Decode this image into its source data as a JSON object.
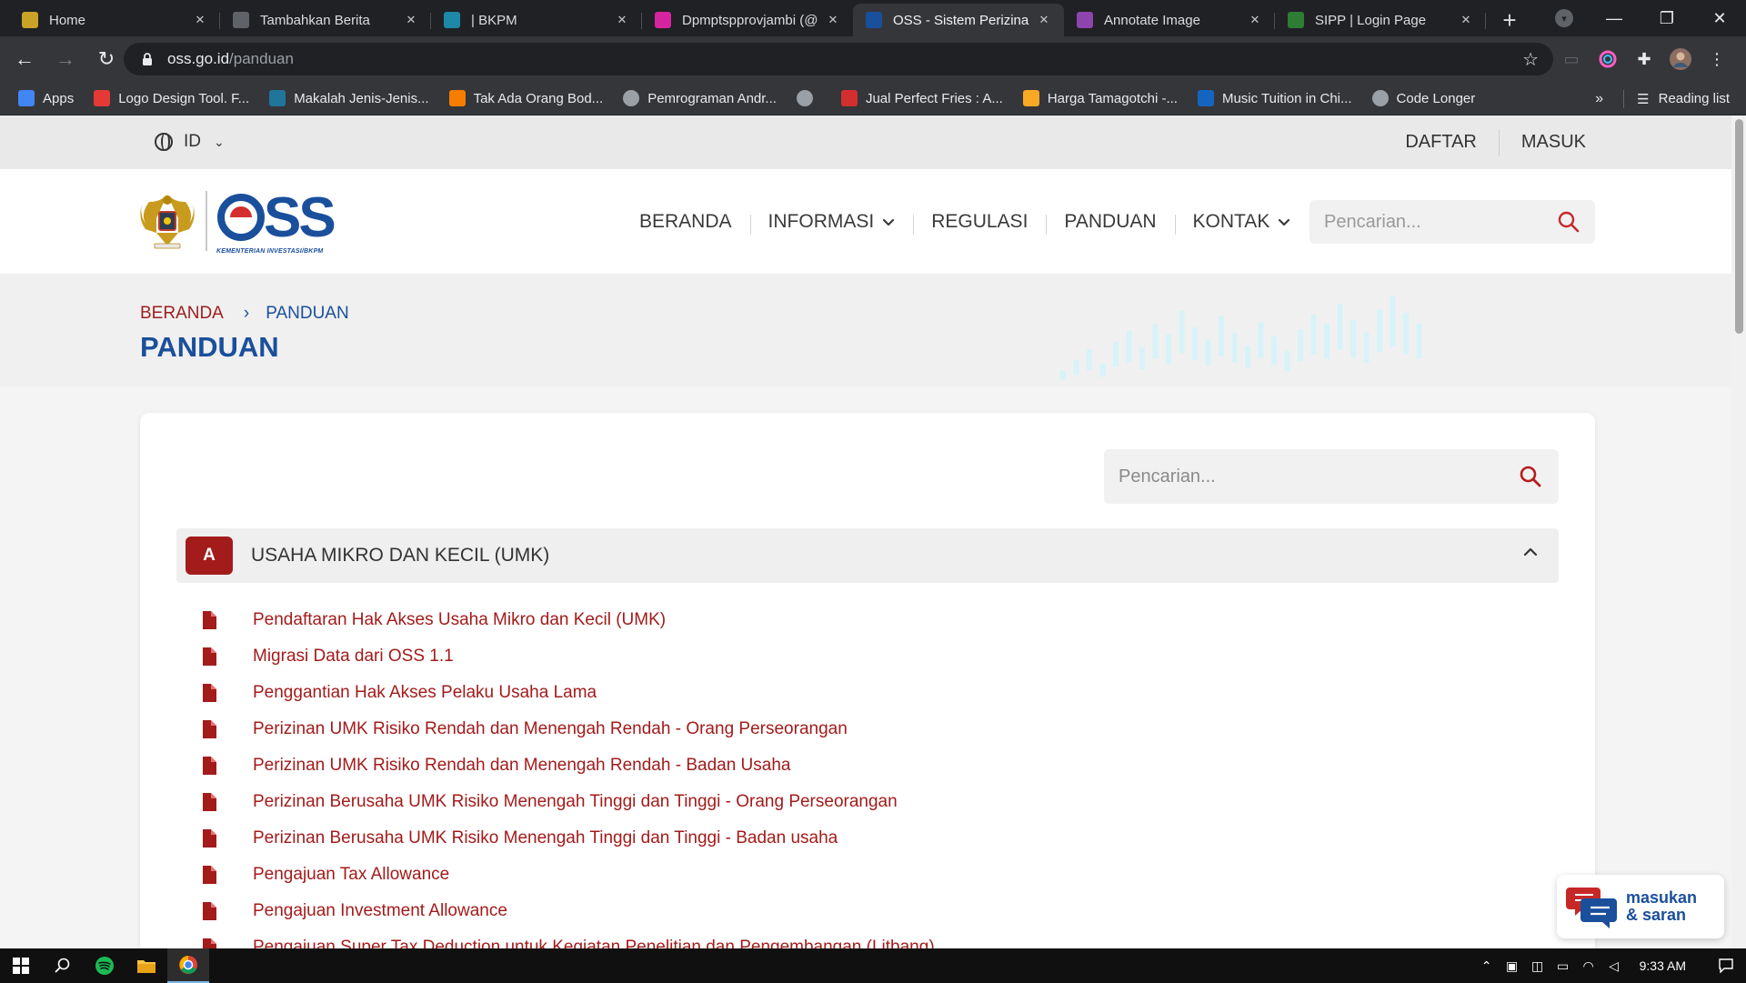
{
  "browser": {
    "tabs": [
      {
        "title": "Home",
        "icon": "castle-icon",
        "color": "#c9a227",
        "active": false
      },
      {
        "title": "Tambahkan Berita",
        "icon": "globe-icon",
        "color": "#5f6368",
        "active": false
      },
      {
        "title": "| BKPM",
        "icon": "bkpm-icon",
        "color": "#1e88a8",
        "active": false
      },
      {
        "title": "Dpmptspprovjambi (@",
        "icon": "instagram-icon",
        "color": "#d6249f",
        "active": false
      },
      {
        "title": "OSS - Sistem Perizinan",
        "icon": "oss-icon",
        "color": "#1a4f9c",
        "active": true
      },
      {
        "title": "Annotate Image",
        "icon": "annotate-icon",
        "color": "#8e44ad",
        "active": false
      },
      {
        "title": "SIPP | Login Page",
        "icon": "sipp-icon",
        "color": "#2e7d32",
        "active": false
      }
    ],
    "url_host": "oss.go.id",
    "url_path": "/panduan",
    "bookmarks": [
      {
        "label": "Apps",
        "icon": "apps-grid-icon",
        "color": "#4285f4"
      },
      {
        "label": "Logo Design Tool. F...",
        "icon": "logo-design-icon",
        "color": "#e53935"
      },
      {
        "label": "Makalah Jenis-Jenis...",
        "icon": "wordpress-icon",
        "color": "#21759b"
      },
      {
        "label": "Tak Ada Orang Bod...",
        "icon": "blogger-icon",
        "color": "#f57d00"
      },
      {
        "label": "Pemrograman Andr...",
        "icon": "globe-icon",
        "color": "#9aa0a6"
      },
      {
        "label": "",
        "icon": "globe-icon",
        "color": "#9aa0a6"
      },
      {
        "label": "Jual Perfect Fries : A...",
        "icon": "um-icon",
        "color": "#d32f2f"
      },
      {
        "label": "Harga Tamagotchi -...",
        "icon": "p-icon",
        "color": "#f9a825"
      },
      {
        "label": "Music Tuition in Chi...",
        "icon": "cm-icon",
        "color": "#1565c0"
      },
      {
        "label": "Code Longer",
        "icon": "code-longer-icon",
        "color": "#9aa0a6"
      }
    ],
    "reading_list": "Reading list"
  },
  "site": {
    "language": "ID",
    "auth": {
      "register": "DAFTAR",
      "login": "MASUK"
    },
    "logo": {
      "word": "OSS",
      "subtitle": "KEMENTERIAN INVESTASI/BKPM"
    },
    "nav": [
      {
        "label": "BERANDA",
        "dropdown": false
      },
      {
        "label": "INFORMASI",
        "dropdown": true
      },
      {
        "label": "REGULASI",
        "dropdown": false
      },
      {
        "label": "PANDUAN",
        "dropdown": false
      },
      {
        "label": "KONTAK",
        "dropdown": true
      }
    ],
    "search_placeholder": "Pencarian...",
    "breadcrumb": {
      "home": "BERANDA",
      "separator": "›",
      "current": "PANDUAN"
    },
    "page_title": "PANDUAN",
    "content_search_placeholder": "Pencarian...",
    "section": {
      "letter": "A",
      "title": "USAHA MIKRO DAN KECIL (UMK)",
      "expanded": true,
      "items": [
        "Pendaftaran Hak Akses Usaha Mikro dan Kecil (UMK)",
        "Migrasi Data dari OSS 1.1",
        "Penggantian Hak Akses Pelaku Usaha Lama",
        "Perizinan UMK Risiko Rendah dan Menengah Rendah - Orang Perseorangan",
        "Perizinan UMK Risiko Rendah dan Menengah Rendah - Badan Usaha",
        "Perizinan Berusaha UMK Risiko Menengah Tinggi dan Tinggi - Orang Perseorangan",
        "Perizinan Berusaha UMK Risiko Menengah Tinggi dan Tinggi - Badan usaha",
        "Pengajuan Tax Allowance",
        "Pengajuan Investment Allowance",
        "Pengajuan Super Tax Deduction untuk Kegiatan Penelitian dan Pengembangan (Litbang)"
      ]
    },
    "feedback": {
      "line1": "masukan",
      "line2": "& saran"
    },
    "colors": {
      "brand_blue": "#1a4f9c",
      "brand_red": "#a31b1b"
    }
  },
  "taskbar": {
    "time": "9:33 AM"
  }
}
